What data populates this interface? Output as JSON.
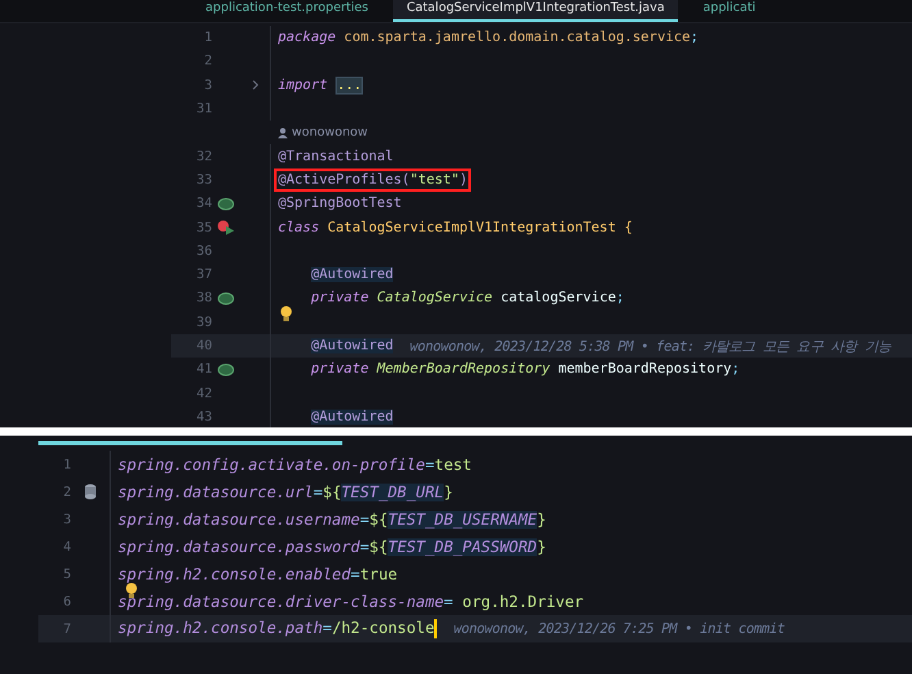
{
  "editor_top": {
    "tabs": [
      {
        "label": "application-test.properties",
        "selected": false
      },
      {
        "label": "CatalogServiceImplV1IntegrationTest.java",
        "selected": true
      },
      {
        "label": "applicati",
        "selected": false
      }
    ],
    "lines": [
      {
        "kind": "code",
        "number": "1",
        "tokens": [
          {
            "kind": "keyword",
            "text": "package"
          },
          {
            "kind": "package",
            "text": " com.sparta.jamrello.domain.catalog.service"
          },
          {
            "kind": "punct",
            "text": ";"
          }
        ]
      },
      {
        "kind": "code",
        "number": "2"
      },
      {
        "kind": "code",
        "number": "3",
        "fold": true,
        "tokens": [
          {
            "kind": "keyword",
            "text": "import"
          },
          {
            "kind": "fold",
            "text": "..."
          }
        ]
      },
      {
        "kind": "code",
        "number": "31"
      },
      {
        "kind": "author",
        "text": "wonowonow"
      },
      {
        "kind": "code",
        "number": "32",
        "tokens": [
          {
            "kind": "annotation",
            "text": "@Transactional"
          }
        ]
      },
      {
        "kind": "code",
        "number": "33",
        "boxed": true,
        "tokens": [
          {
            "kind": "annotation",
            "text": "@ActiveProfiles("
          },
          {
            "kind": "string",
            "text": "\"test\""
          },
          {
            "kind": "annotation",
            "text": ")"
          }
        ]
      },
      {
        "kind": "code",
        "number": "34",
        "gutter": {
          "kind": "bean"
        },
        "tokens": [
          {
            "kind": "annotation",
            "text": "@SpringBootTest"
          }
        ]
      },
      {
        "kind": "code",
        "number": "35",
        "gutter": {
          "kind": "run"
        },
        "tokens": [
          {
            "kind": "keyword",
            "text": "class"
          },
          {
            "kind": "class",
            "text": " CatalogServiceImplV1IntegrationTest {"
          }
        ]
      },
      {
        "kind": "code",
        "number": "36"
      },
      {
        "kind": "code",
        "number": "37",
        "indent": true,
        "tokens": [
          {
            "kind": "annotation_usage",
            "text": "@Autowired"
          }
        ]
      },
      {
        "kind": "code",
        "number": "38",
        "indent": true,
        "gutter": {
          "kind": "bean"
        },
        "tokens": [
          {
            "kind": "keyword",
            "text": "private"
          },
          {
            "kind": "type",
            "text": " CatalogService"
          },
          {
            "kind": "ident",
            "text": " catalogService"
          },
          {
            "kind": "punct",
            "text": ";"
          }
        ]
      },
      {
        "kind": "code",
        "number": "39",
        "bulb": true
      },
      {
        "kind": "code",
        "number": "40",
        "indent": true,
        "current": true,
        "blame": "wonowonow, 2023/12/28 5:38 PM • feat: 카탈로그 모든 요구 사항 기능",
        "tokens": [
          {
            "kind": "annotation_usage",
            "text": "@Autowired"
          }
        ]
      },
      {
        "kind": "code",
        "number": "41",
        "indent": true,
        "gutter": {
          "kind": "bean"
        },
        "tokens": [
          {
            "kind": "keyword",
            "text": "private"
          },
          {
            "kind": "type",
            "text": " MemberBoardRepository"
          },
          {
            "kind": "ident",
            "text": " memberBoardRepository"
          },
          {
            "kind": "punct",
            "text": ";"
          }
        ]
      },
      {
        "kind": "code",
        "number": "42"
      },
      {
        "kind": "code",
        "number": "43",
        "indent": true,
        "tokens": [
          {
            "kind": "annotation_usage",
            "text": "@Autowired"
          }
        ]
      }
    ]
  },
  "editor_bottom": {
    "lines": [
      {
        "kind": "code",
        "number": "1",
        "tokens": [
          {
            "kind": "key",
            "text": "spring.config.activate.on-profile"
          },
          {
            "kind": "punct",
            "text": "="
          },
          {
            "kind": "value",
            "text": "test"
          }
        ]
      },
      {
        "kind": "code",
        "number": "2",
        "gutter": {
          "kind": "database"
        },
        "tokens": [
          {
            "kind": "key",
            "text": "spring.datasource.url"
          },
          {
            "kind": "punct",
            "text": "="
          },
          {
            "kind": "value",
            "text": "${"
          },
          {
            "kind": "variable",
            "text": "TEST_DB_URL"
          },
          {
            "kind": "value",
            "text": "}"
          }
        ]
      },
      {
        "kind": "code",
        "number": "3",
        "tokens": [
          {
            "kind": "key",
            "text": "spring.datasource.username"
          },
          {
            "kind": "punct",
            "text": "="
          },
          {
            "kind": "value",
            "text": "${"
          },
          {
            "kind": "variable",
            "text": "TEST_DB_USERNAME"
          },
          {
            "kind": "value",
            "text": "}"
          }
        ]
      },
      {
        "kind": "code",
        "number": "4",
        "tokens": [
          {
            "kind": "key",
            "text": "spring.datasource.password"
          },
          {
            "kind": "punct",
            "text": "="
          },
          {
            "kind": "value",
            "text": "${"
          },
          {
            "kind": "variable",
            "text": "TEST_DB_PASSWORD"
          },
          {
            "kind": "value",
            "text": "}"
          }
        ]
      },
      {
        "kind": "code",
        "number": "5",
        "tokens": [
          {
            "kind": "key",
            "text": "spring.h2.console.enabled"
          },
          {
            "kind": "punct",
            "text": "="
          },
          {
            "kind": "value",
            "text": "true"
          }
        ]
      },
      {
        "kind": "code",
        "number": "6",
        "bulb": true,
        "tokens": [
          {
            "kind": "key",
            "text": "spring.datasource.driver-class-name"
          },
          {
            "kind": "punct",
            "text": "="
          },
          {
            "kind": "value",
            "text": " org.h2.Driver"
          }
        ]
      },
      {
        "kind": "code",
        "number": "7",
        "current": true,
        "caret": true,
        "blame": "wonowonow, 2023/12/26 7:25 PM • init commit",
        "tokens": [
          {
            "kind": "key",
            "text": "spring.h2.console.path"
          },
          {
            "kind": "punct",
            "text": "="
          },
          {
            "kind": "value",
            "text": "/h2-console"
          }
        ]
      }
    ]
  }
}
